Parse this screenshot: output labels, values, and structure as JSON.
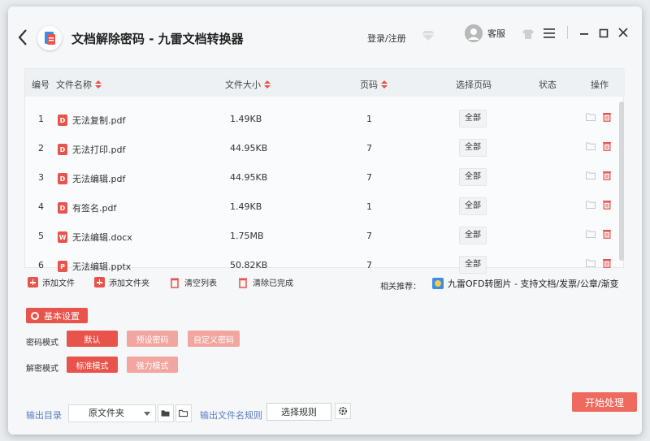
{
  "window": {
    "title": "文档解除密码 - 九雷文档转换器",
    "login": "登录/注册",
    "service": "客服"
  },
  "table": {
    "headers": {
      "index": "编号",
      "name": "文件名称",
      "size": "文件大小",
      "pages": "页码",
      "select_pages": "选择页码",
      "status": "状态",
      "actions": "操作"
    },
    "rows": [
      {
        "index": "1",
        "name": "无法复制.pdf",
        "type": "pdf",
        "icon_letter": "D",
        "size": "1.49KB",
        "pages": "1",
        "select": "全部"
      },
      {
        "index": "2",
        "name": "无法打印.pdf",
        "type": "pdf",
        "icon_letter": "D",
        "size": "44.95KB",
        "pages": "7",
        "select": "全部"
      },
      {
        "index": "3",
        "name": "无法编辑.pdf",
        "type": "pdf",
        "icon_letter": "D",
        "size": "44.95KB",
        "pages": "7",
        "select": "全部"
      },
      {
        "index": "4",
        "name": "有签名.pdf",
        "type": "pdf",
        "icon_letter": "D",
        "size": "1.49KB",
        "pages": "1",
        "select": "全部"
      },
      {
        "index": "5",
        "name": "无法编辑.docx",
        "type": "docx",
        "icon_letter": "W",
        "size": "1.75MB",
        "pages": "7",
        "select": "全部"
      },
      {
        "index": "6",
        "name": "无法编辑.pptx",
        "type": "pptx",
        "icon_letter": "P",
        "size": "50.82KB",
        "pages": "7",
        "select": "全部"
      }
    ]
  },
  "actions": {
    "add_file": "添加文件",
    "add_folder": "添加文件夹",
    "clear_list": "清空列表",
    "clear_done": "清除已完成",
    "related_label": "相关推荐：",
    "related_link": "九雷OFD转图片 - 支持文档/发票/公章/渐变"
  },
  "settings": {
    "title": "基本设置",
    "password_mode_label": "密码模式",
    "password_modes": [
      "默认",
      "预设密码",
      "自定义密码"
    ],
    "decrypt_mode_label": "解密模式",
    "decrypt_modes": [
      "标准模式",
      "强力模式"
    ]
  },
  "output": {
    "dir_label": "输出目录",
    "dir_value": "原文件夹",
    "rule_label": "输出文件名规则",
    "rule_button": "选择规则",
    "start_button": "开始处理"
  },
  "colors": {
    "accent": "#e8544b",
    "accent_light": "#f2a6a0",
    "link_blue": "#5a7ec4"
  }
}
